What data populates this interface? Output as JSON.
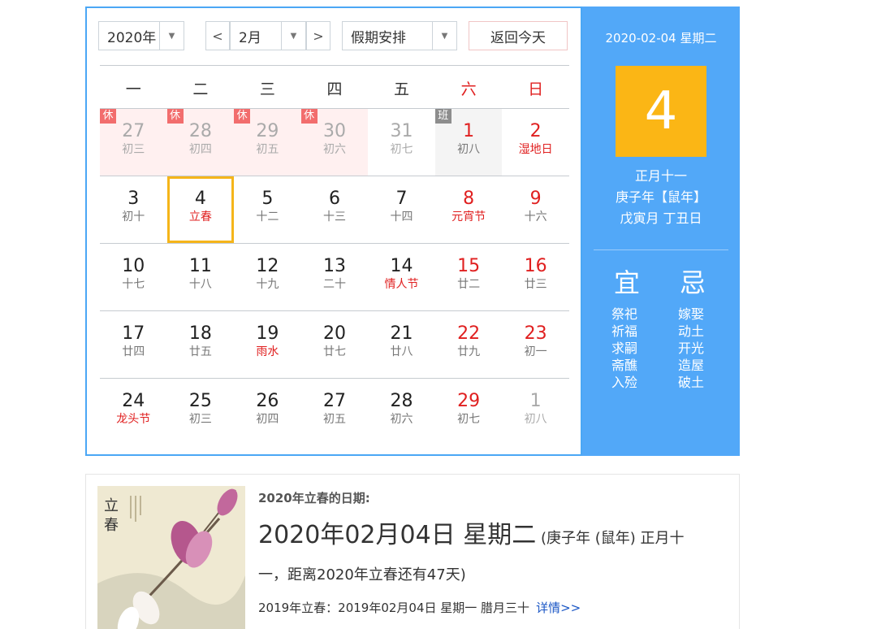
{
  "toolbar": {
    "year": "2020年",
    "month": "2月",
    "prev": "<",
    "next": ">",
    "holiday": "假期安排",
    "today_button": "返回今天",
    "dropdown_arrow": "▼"
  },
  "weekdays": [
    "一",
    "二",
    "三",
    "四",
    "五",
    "六",
    "日"
  ],
  "weeks": [
    [
      {
        "num": "27",
        "lunar": "初三",
        "tag": "休",
        "tagType": "rest",
        "other": true,
        "holiday": true
      },
      {
        "num": "28",
        "lunar": "初四",
        "tag": "休",
        "tagType": "rest",
        "other": true,
        "holiday": true
      },
      {
        "num": "29",
        "lunar": "初五",
        "tag": "休",
        "tagType": "rest",
        "other": true,
        "holiday": true
      },
      {
        "num": "30",
        "lunar": "初六",
        "tag": "休",
        "tagType": "rest",
        "other": true,
        "holiday": true
      },
      {
        "num": "31",
        "lunar": "初七",
        "other": true
      },
      {
        "num": "1",
        "lunar": "初八",
        "tag": "班",
        "tagType": "work",
        "weekend": true,
        "workday": true
      },
      {
        "num": "2",
        "lunar": "湿地日",
        "weekend": true,
        "fest": true
      }
    ],
    [
      {
        "num": "3",
        "lunar": "初十"
      },
      {
        "num": "4",
        "lunar": "立春",
        "fest": true,
        "today": true
      },
      {
        "num": "5",
        "lunar": "十二"
      },
      {
        "num": "6",
        "lunar": "十三"
      },
      {
        "num": "7",
        "lunar": "十四"
      },
      {
        "num": "8",
        "lunar": "元宵节",
        "weekend": true,
        "fest": true
      },
      {
        "num": "9",
        "lunar": "十六",
        "weekend": true
      }
    ],
    [
      {
        "num": "10",
        "lunar": "十七"
      },
      {
        "num": "11",
        "lunar": "十八"
      },
      {
        "num": "12",
        "lunar": "十九"
      },
      {
        "num": "13",
        "lunar": "二十"
      },
      {
        "num": "14",
        "lunar": "情人节",
        "fest": true
      },
      {
        "num": "15",
        "lunar": "廿二",
        "weekend": true
      },
      {
        "num": "16",
        "lunar": "廿三",
        "weekend": true
      }
    ],
    [
      {
        "num": "17",
        "lunar": "廿四"
      },
      {
        "num": "18",
        "lunar": "廿五"
      },
      {
        "num": "19",
        "lunar": "雨水",
        "fest": true
      },
      {
        "num": "20",
        "lunar": "廿七"
      },
      {
        "num": "21",
        "lunar": "廿八"
      },
      {
        "num": "22",
        "lunar": "廿九",
        "weekend": true
      },
      {
        "num": "23",
        "lunar": "初一",
        "weekend": true
      }
    ],
    [
      {
        "num": "24",
        "lunar": "龙头节",
        "fest": true
      },
      {
        "num": "25",
        "lunar": "初三"
      },
      {
        "num": "26",
        "lunar": "初四"
      },
      {
        "num": "27",
        "lunar": "初五"
      },
      {
        "num": "28",
        "lunar": "初六"
      },
      {
        "num": "29",
        "lunar": "初七",
        "weekend": true
      },
      {
        "num": "1",
        "lunar": "初八",
        "other": true
      }
    ]
  ],
  "side": {
    "date": "2020-02-04 星期二",
    "day": "4",
    "lunar_date": "正月十一",
    "lunar_year": "庚子年【鼠年】",
    "ganzhi": "戊寅月 丁丑日",
    "yi": "宜",
    "ji": "忌",
    "yi_items": [
      "祭祀",
      "祈福",
      "求嗣",
      "斋醮",
      "入殓"
    ],
    "ji_items": [
      "嫁娶",
      "动土",
      "开光",
      "造屋",
      "破土"
    ]
  },
  "article": {
    "subtitle": "2020年立春的日期:",
    "date_big": "2020年02月04日 星期二",
    "date_small": " (庚子年 (鼠年) 正月十",
    "line2": "一，距离2020年立春还有47天)",
    "footer": "2019年立春：2019年02月04日 星期一 腊月三十",
    "details_link": "详情>>",
    "image_chars": [
      "立",
      "春"
    ]
  },
  "colors": {
    "accent_blue": "#4ba7f5",
    "side_bg": "#52a8f8",
    "today_gold": "#fbb615",
    "festival_red": "#e02020"
  }
}
